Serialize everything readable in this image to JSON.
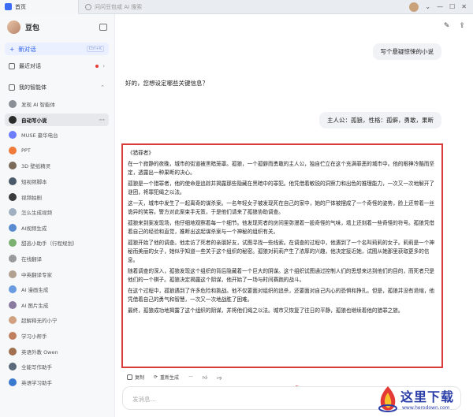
{
  "browser": {
    "tab_title": "首页",
    "url_placeholder": "问问豆包或 AI 搜索"
  },
  "sidebar": {
    "brand": "豆包",
    "new_chat": "新对话",
    "new_chat_shortcut": "Ctrl+K",
    "recent": "最近对话",
    "my_agents": "我的智能体",
    "agents": [
      {
        "label": "发现 AI 智能体",
        "color": "#8a8f98"
      },
      {
        "label": "自动写小说",
        "color": "#2b2b2b",
        "active": true
      },
      {
        "label": "MUSE 豪华电台",
        "color": "#6b7cff"
      },
      {
        "label": "PPT",
        "color": "#f07a3a"
      },
      {
        "label": "3D 壁纸精灵",
        "color": "#7a6a5a"
      },
      {
        "label": "短视频脚本",
        "color": "#4a5a6a"
      },
      {
        "label": "视频拍剧",
        "color": "#3a3a3a"
      },
      {
        "label": "怎么生成视频",
        "color": "#a0b0c0"
      },
      {
        "label": "AI视频生成",
        "color": "#5a8ad0"
      },
      {
        "label": "甜逃小助手（行程规划）",
        "color": "#7ab070"
      },
      {
        "label": "在线翻译",
        "color": "#9a9a9a"
      },
      {
        "label": "中英翻译专家",
        "color": "#b0a090"
      },
      {
        "label": "AI 漫画生成",
        "color": "#6a9ae0"
      },
      {
        "label": "AI 图片生成",
        "color": "#8a7aa0"
      },
      {
        "label": "超解释无的小宁",
        "color": "#d0a080"
      },
      {
        "label": "学习小帮手",
        "color": "#c08060"
      },
      {
        "label": "英语外教 Owen",
        "color": "#a07050"
      },
      {
        "label": "全能写作助手",
        "color": "#5a6a7a"
      },
      {
        "label": "英语学习助手",
        "color": "#3a7ad0"
      }
    ]
  },
  "chat": {
    "user_msg_1": "写个悬疑惊悚的小说",
    "bot_msg_1": "好的，您想设定哪些关键信息？",
    "user_msg_2": "主人公：孤狼，性格：孤僻，勇敢，果断",
    "story_title": "《猎罪者》",
    "story_paragraphs": [
      "在一个寂静的夜晚，城市的街道被黑暗笼罩。孤狼，一个孤僻而勇敢的主人公，独自伫立在这个充满罪恶的城市中。他的眼神冷酷而坚定，透露出一种果断的决心。",
      "孤狼是一个猎罪者，他的使命是追踪并揭露那些隐藏在黑暗中的罪犯。他凭借着敏锐的洞察力和出色的推理能力，一次又一次地解开了谜团，将罪犯绳之以法。",
      "这一天，城市中发生了一起离奇的谋杀案。一名年轻女子被发现死在自己的家中，她的尸体被摆成了一个奇怪的姿势，脸上还带着一丝诡异的笑容。警方对此案束手无策，于是他们请来了孤狼协助调查。",
      "孤狼来到案发现场，他仔细地观察着每一个细节。他发现死者的房间里弥漫着一股奇怪的气味，墙上还刻着一些奇怪的符号。孤狼凭借着自己的经验和直觉，推断出这起谋杀案与一个神秘的组织有关。",
      "孤狼开始了他的调查。他走访了死者的亲朋好友，试图寻找一些线索。在调查的过程中，他遇到了一个名叫莉莉的女子。莉莉是一个神秘而美丽的女子，她似乎知道一些关于这个组织的秘密。孤狼对莉莉产生了浓厚的兴趣，他决定接近她，试图从她那里获取更多的信息。",
      "随着调查的深入，孤狼发现这个组织的背后隐藏着一个巨大的阴谋。这个组织试图通过控制人们的思想来达到他们的目的，而死者只是他们的一个棋子。孤狼决定揭露这个阴谋，他开始了一场与时间赛跑的战斗。",
      "在这个过程中，孤狼遇到了许多危险和挑战。他不仅要面对组织的追杀，还要面对自己内心的恐惧和挣扎。但是，孤狼并没有退缩，他凭借着自己的勇气和智慧，一次又一次地战胜了困难。",
      "最终，孤狼成功地揭露了这个组织的阴谋，并将他们绳之以法。城市又恢复了往日的平静，孤狼也继续着他的猎罪之旅。"
    ],
    "copy_label": "复制",
    "regenerate_label": "重新生成",
    "input_placeholder": "发消息..."
  },
  "watermark": {
    "text": "这里下载",
    "url": "www.herodown.com"
  },
  "colors": {
    "accent": "#2f5fe8",
    "highlight_border": "#d93b3b"
  }
}
